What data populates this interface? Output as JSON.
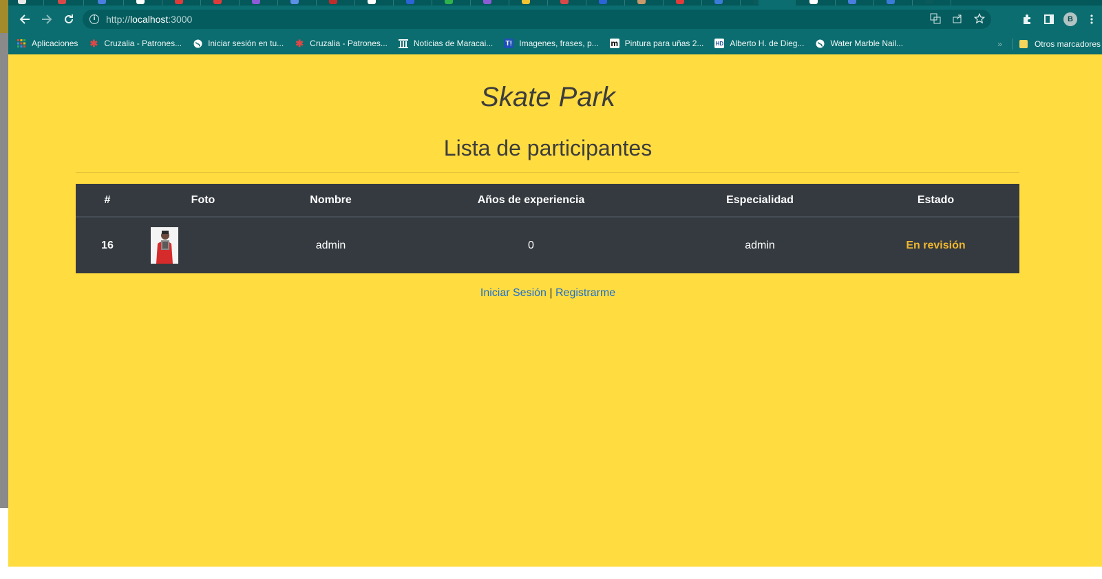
{
  "browser": {
    "url_host": "localhost",
    "url_rest": ":3000",
    "url_prefix": "http://",
    "profile_initial": "B",
    "bookmarks": [
      {
        "label": "Aplicaciones",
        "icon": "apps-grid-icon",
        "color": "#f1c232"
      },
      {
        "label": "Cruzalia - Patrones...",
        "icon": "cruzalia-icon",
        "color": "#e04646"
      },
      {
        "label": "Iniciar sesión en tu...",
        "icon": "globe-icon",
        "color": "#ffffff"
      },
      {
        "label": "Cruzalia - Patrones...",
        "icon": "cruzalia-icon",
        "color": "#e04646"
      },
      {
        "label": "Noticias de Maracai...",
        "icon": "news-icon",
        "color": "#ffffff"
      },
      {
        "label": "Imagenes, frases, p...",
        "icon": "t-icon",
        "color": "#2c63d6"
      },
      {
        "label": "Pintura para uñas 2...",
        "icon": "m-icon",
        "color": "#000000"
      },
      {
        "label": "Alberto H. de Dieg...",
        "icon": "hd-icon",
        "color": "#1d4f9c"
      },
      {
        "label": "Water Marble Nail...",
        "icon": "globe-icon",
        "color": "#ffffff"
      }
    ],
    "other_bookmarks": "Otros marcadores"
  },
  "page": {
    "site_title": "Skate Park",
    "list_title": "Lista de participantes",
    "table": {
      "headers": [
        "#",
        "Foto",
        "Nombre",
        "Años de experiencia",
        "Especialidad",
        "Estado"
      ],
      "rows": [
        {
          "id": "16",
          "nombre": "admin",
          "experiencia": "0",
          "especialidad": "admin",
          "estado": "En revisión"
        }
      ]
    },
    "login_link": "Iniciar Sesión",
    "separator": "|",
    "register_link": "Registrarme"
  },
  "colors": {
    "page_bg": "#ffdc40",
    "table_bg": "#343a40",
    "status_color": "#f0b731",
    "link_color": "#1a6fd0",
    "chrome_theme": "#0b6d6f"
  }
}
